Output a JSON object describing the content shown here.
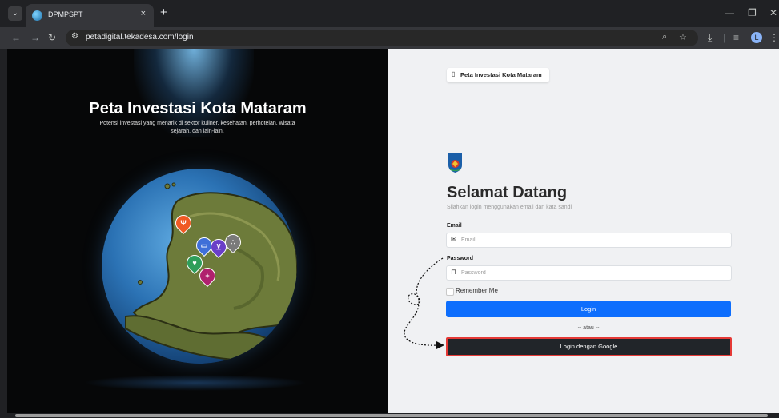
{
  "browser": {
    "tab_title": "DPMPSPT",
    "tab_close": "×",
    "new_tab": "+",
    "url": "petadigital.tekadesa.com/login",
    "profile_initial": "L",
    "window_controls": {
      "minimize": "—",
      "restore": "❐",
      "close": "✕"
    }
  },
  "hero": {
    "title": "Peta Investasi Kota Mataram",
    "subtitle": "Potensi investasi yang menarik di sektor kuliner, kesehatan, perhotelan, wisata sejarah, dan lain-lain."
  },
  "map_pins": [
    {
      "icon": "fork-knife-icon",
      "color": "#f05a24"
    },
    {
      "icon": "hotel-icon",
      "color": "#3f6fd8"
    },
    {
      "icon": "cart-icon",
      "color": "#6a3fc8"
    },
    {
      "icon": "landmark-icon",
      "color": "#7a7a7a"
    },
    {
      "icon": "hands-icon",
      "color": "#2f9e5a"
    },
    {
      "icon": "health-icon",
      "color": "#b0206e"
    }
  ],
  "login": {
    "brand_chip": "Peta Investasi Kota Mataram",
    "crest_label": "KOTA MATARAM",
    "heading": "Selamat Datang",
    "instruction": "Silahkan login menggunakan email dan kata sandi",
    "email_label": "Email",
    "email_placeholder": "Email",
    "email_value": "",
    "password_label": "Password",
    "password_placeholder": "Password",
    "password_value": "",
    "remember_label": "Remember Me",
    "remember_checked": false,
    "login_button": "Login",
    "divider": "-- atau --",
    "google_button": "Login dengan Google"
  },
  "colors": {
    "primary": "#0d6efd",
    "google_button_bg": "#212529",
    "highlight_border": "#e53935",
    "right_bg": "#f0f1f3",
    "left_bg": "#060708"
  }
}
